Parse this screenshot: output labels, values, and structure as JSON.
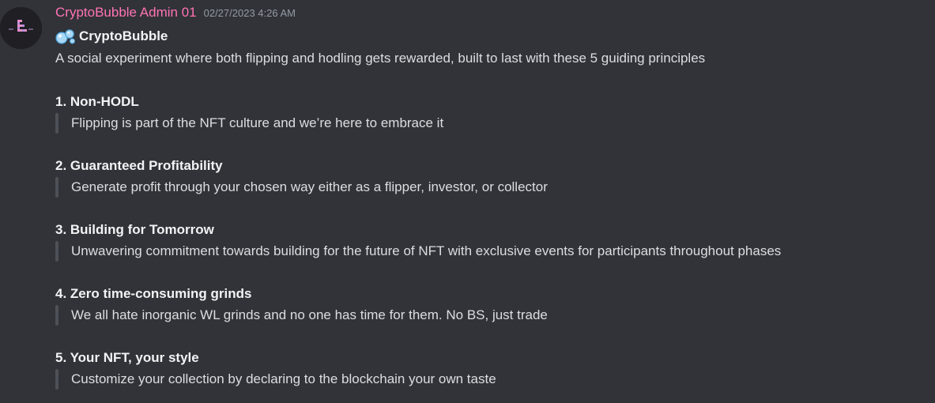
{
  "message": {
    "author": "CryptoBubble Admin 01",
    "timestamp": "02/27/2023 4:26 AM",
    "author_color": "#ff73b4",
    "avatar_icon": "cryptobubble-logo-icon",
    "title_icon": "bubbles-emoji-icon",
    "title": "CryptoBubble",
    "intro": "A social experiment where both flipping and hodling gets rewarded, built to last with these 5 guiding principles",
    "principles": [
      {
        "heading": "1. Non-HODL",
        "text": "Flipping is part of the NFT culture and we’re here to embrace it"
      },
      {
        "heading": "2. Guaranteed Profitability",
        "text": "Generate profit through your chosen way either as a flipper, investor, or collector"
      },
      {
        "heading": "3. Building for Tomorrow",
        "text": "Unwavering commitment towards building for the future of NFT with exclusive events for participants throughout phases"
      },
      {
        "heading": "4. Zero time-consuming grinds",
        "text": "We all hate inorganic WL grinds and no one has time for them. No BS, just trade"
      },
      {
        "heading": "5. Your NFT, your style",
        "text": "Customize your collection by declaring to the blockchain your own taste"
      }
    ]
  }
}
